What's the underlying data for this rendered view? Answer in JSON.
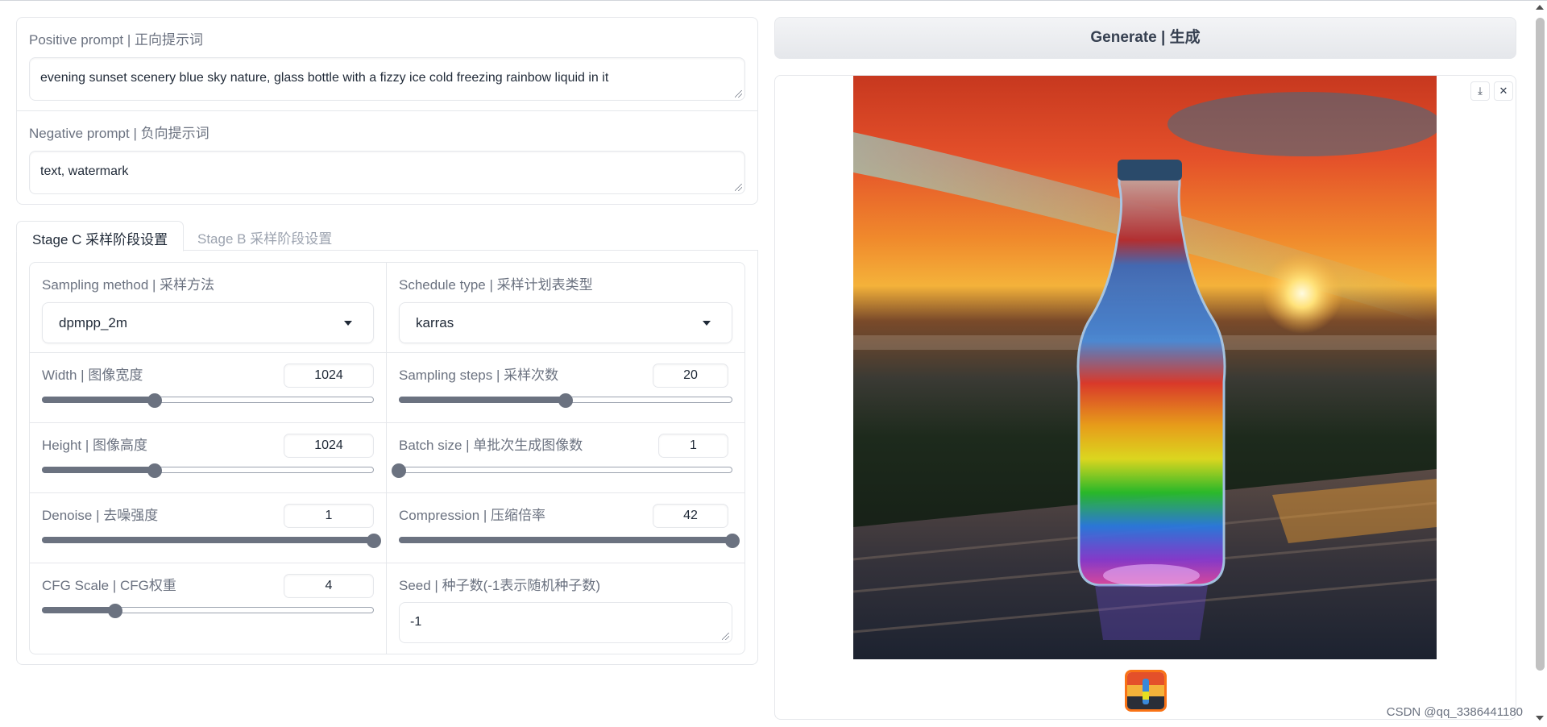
{
  "prompts": {
    "positive_label": "Positive prompt | 正向提示词",
    "positive_value": "evening sunset scenery blue sky nature, glass bottle with a fizzy ice cold freezing rainbow liquid in it",
    "negative_label": "Negative prompt | 负向提示词",
    "negative_value": "text, watermark"
  },
  "tabs": [
    {
      "label": "Stage C 采样阶段设置",
      "active": true
    },
    {
      "label": "Stage B 采样阶段设置",
      "active": false
    }
  ],
  "settings": {
    "sampling_method": {
      "label": "Sampling method | 采样方法",
      "value": "dpmpp_2m"
    },
    "schedule_type": {
      "label": "Schedule type | 采样计划表类型",
      "value": "karras"
    },
    "width": {
      "label": "Width | 图像宽度",
      "value": "1024",
      "fraction": 0.34
    },
    "sampling_steps": {
      "label": "Sampling steps | 采样次数",
      "value": "20",
      "fraction": 0.5
    },
    "height": {
      "label": "Height | 图像高度",
      "value": "1024",
      "fraction": 0.34
    },
    "batch_size": {
      "label": "Batch size | 单批次生成图像数",
      "value": "1",
      "fraction": 0.0
    },
    "denoise": {
      "label": "Denoise | 去噪强度",
      "value": "1",
      "fraction": 1.0
    },
    "compression": {
      "label": "Compression | 压缩倍率",
      "value": "42",
      "fraction": 1.0
    },
    "cfg_scale": {
      "label": "CFG Scale | CFG权重",
      "value": "4",
      "fraction": 0.22
    },
    "seed": {
      "label": "Seed | 种子数(-1表示随机种子数)",
      "value": "-1"
    }
  },
  "generate_label": "Generate | 生成",
  "gallery": {
    "download_icon": "download-icon",
    "close_icon": "close-icon",
    "download_glyph": "⤓",
    "close_glyph": "✕"
  },
  "watermark": "CSDN @qq_3386441180",
  "colors": {
    "accent": "#f97316",
    "slider": "#6b7280"
  }
}
